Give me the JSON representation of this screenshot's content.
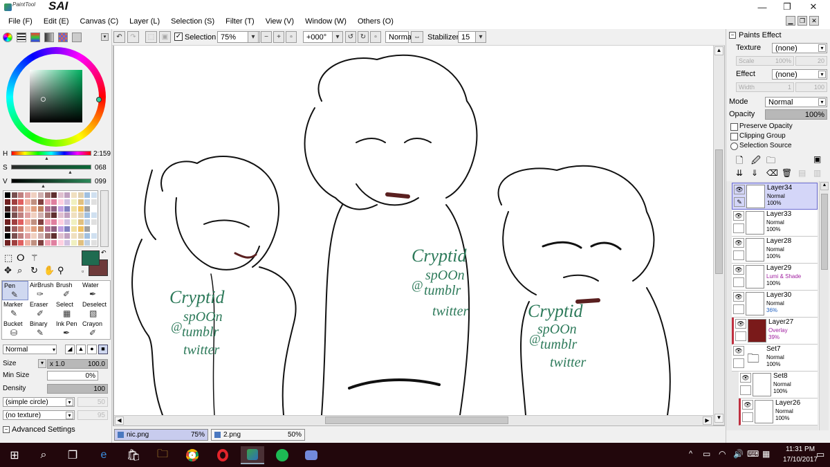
{
  "app": {
    "logo_small": "PaintTool",
    "logo_big": "SAI"
  },
  "window_controls": {
    "minimize": "—",
    "restore": "❐",
    "close": "✕"
  },
  "menu": [
    "File (F)",
    "Edit (E)",
    "Canvas (C)",
    "Layer (L)",
    "Selection (S)",
    "Filter (T)",
    "View (V)",
    "Window (W)",
    "Others (O)"
  ],
  "toolbar": {
    "selection_label": "Selection",
    "zoom": "75%",
    "rotation": "+000°",
    "mode": "Normal",
    "stabilizer_label": "Stabilizer",
    "stabilizer_value": "15"
  },
  "color": {
    "h_label": "H",
    "h_value": "2:159",
    "s_label": "S",
    "s_value": "068",
    "v_label": "V",
    "v_value": "099",
    "primary": "#1f6b50",
    "secondary": "#6e3a3a"
  },
  "tools": [
    {
      "name": "Pen",
      "icon": "✎"
    },
    {
      "name": "AirBrush",
      "icon": "✑"
    },
    {
      "name": "Brush",
      "icon": "✐"
    },
    {
      "name": "Water",
      "icon": "✒"
    },
    {
      "name": "Marker",
      "icon": "✎"
    },
    {
      "name": "Eraser",
      "icon": "✐"
    },
    {
      "name": "Select",
      "icon": "▦"
    },
    {
      "name": "Deselect",
      "icon": "▧"
    },
    {
      "name": "Bucket",
      "icon": "⛁"
    },
    {
      "name": "Binary",
      "icon": "✎"
    },
    {
      "name": "Ink Pen",
      "icon": "✒"
    },
    {
      "name": "Crayon",
      "icon": "✐"
    }
  ],
  "brush": {
    "blend": "Normal",
    "size_label": "Size",
    "size_mult": "x 1.0",
    "size_value": "100.0",
    "minsize_label": "Min Size",
    "minsize_value": "0%",
    "density_label": "Density",
    "density_value": "100",
    "shape": "(simple circle)",
    "shape_value": "50",
    "texture": "(no texture)",
    "texture_value": "95",
    "advanced": "Advanced Settings"
  },
  "doc_tabs": [
    {
      "name": "nic.png",
      "zoom": "75%"
    },
    {
      "name": "2.png",
      "zoom": "50%"
    }
  ],
  "canvas_texts": [
    "Cryptid",
    "spOOn",
    "@",
    "tumblr",
    "twitter"
  ],
  "paints_effect": {
    "title": "Paints Effect",
    "texture_label": "Texture",
    "texture_value": "(none)",
    "scale_label": "Scale",
    "scale_value": "100%",
    "scale_num": "20",
    "effect_label": "Effect",
    "effect_value": "(none)",
    "width_label": "Width",
    "width_value": "1",
    "width_num": "100"
  },
  "layer_props": {
    "mode_label": "Mode",
    "mode_value": "Normal",
    "opacity_label": "Opacity",
    "opacity_value": "100%",
    "preserve_opacity": "Preserve Opacity",
    "clipping_group": "Clipping Group",
    "selection_source": "Selection Source"
  },
  "layers": [
    {
      "name": "Layer34",
      "mode": "Normal",
      "opacity": "100%",
      "selected": true
    },
    {
      "name": "Layer33",
      "mode": "Normal",
      "opacity": "100%"
    },
    {
      "name": "Layer28",
      "mode": "Normal",
      "opacity": "100%"
    },
    {
      "name": "Layer29",
      "mode": "Lumi & Shade",
      "opacity": "100%"
    },
    {
      "name": "Layer30",
      "mode": "Normal",
      "opacity": "36%"
    },
    {
      "name": "Layer27",
      "mode": "Overlay",
      "opacity": "39%"
    },
    {
      "name": "Set7",
      "mode": "Normal",
      "opacity": "100%"
    },
    {
      "name": "Set8",
      "mode": "Normal",
      "opacity": "100%"
    },
    {
      "name": "Layer26",
      "mode": "Normal",
      "opacity": "100%"
    }
  ],
  "taskbar": {
    "time": "11:31 PM",
    "date": "17/10/2017"
  }
}
